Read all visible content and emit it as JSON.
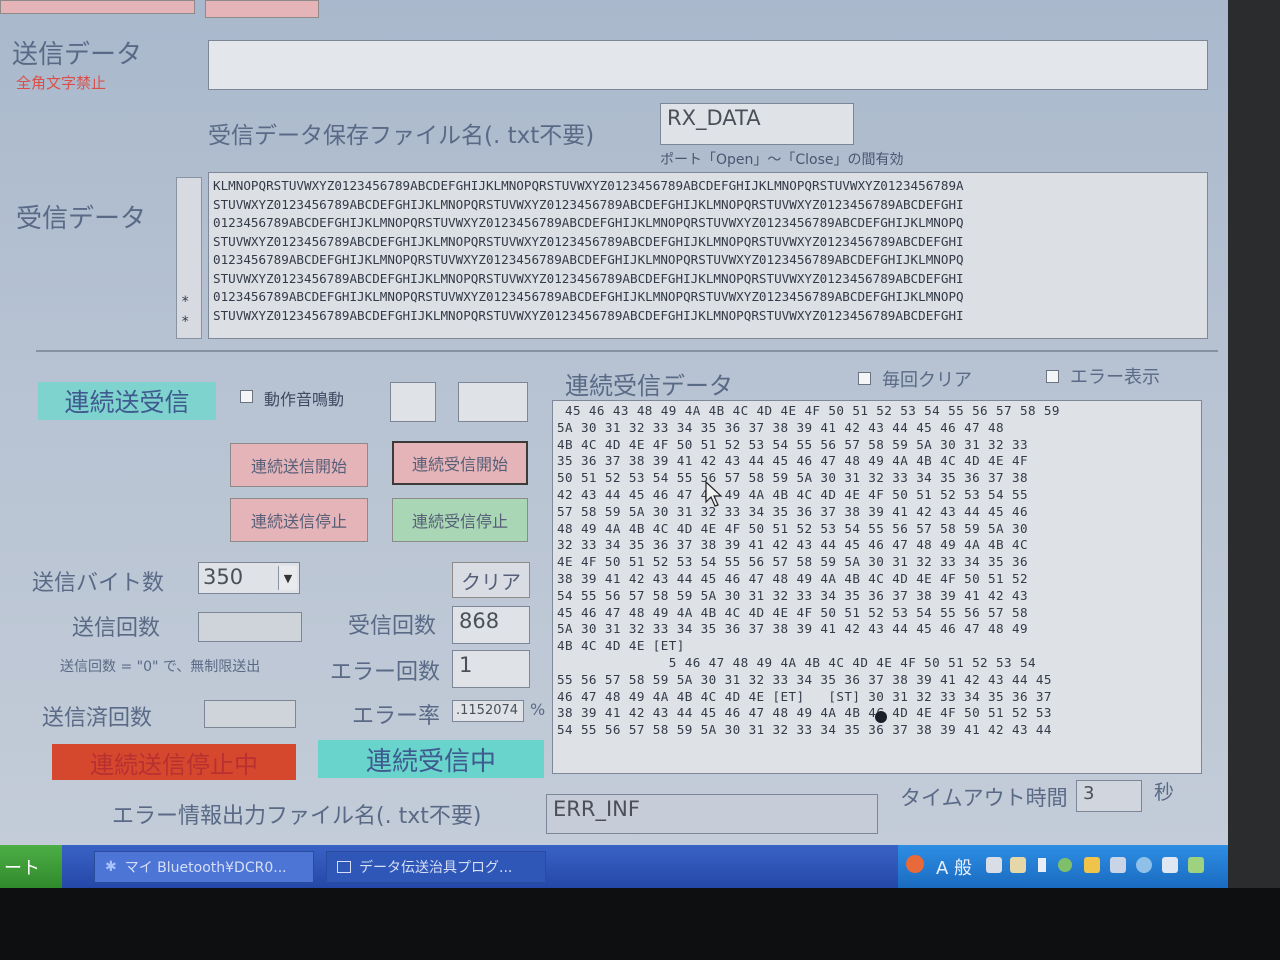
{
  "send": {
    "label": "送信データ",
    "note": "全角文字禁止",
    "value": ""
  },
  "rx_file": {
    "label": "受信データ保存ファイル名(. txt不要)",
    "value": "RX_DATA",
    "note": "ポート「Open」～「Close」の間有効"
  },
  "rx": {
    "label": "受信データ",
    "lines": [
      "KLMNOPQRSTUVWXYZ0123456789ABCDEFGHIJKLMNOPQRSTUVWXYZ0123456789ABCDEFGHIJKLMNOPQRSTUVWXYZ0123456789A",
      "STUVWXYZ0123456789ABCDEFGHIJKLMNOPQRSTUVWXYZ0123456789ABCDEFGHIJKLMNOPQRSTUVWXYZ0123456789ABCDEFGHI",
      "0123456789ABCDEFGHIJKLMNOPQRSTUVWXYZ0123456789ABCDEFGHIJKLMNOPQRSTUVWXYZ0123456789ABCDEFGHIJKLMNOPQ",
      "STUVWXYZ0123456789ABCDEFGHIJKLMNOPQRSTUVWXYZ0123456789ABCDEFGHIJKLMNOPQRSTUVWXYZ0123456789ABCDEFGHI",
      "0123456789ABCDEFGHIJKLMNOPQRSTUVWXYZ0123456789ABCDEFGHIJKLMNOPQRSTUVWXYZ0123456789ABCDEFGHIJKLMNOPQ",
      "STUVWXYZ0123456789ABCDEFGHIJKLMNOPQRSTUVWXYZ0123456789ABCDEFGHIJKLMNOPQRSTUVWXYZ0123456789ABCDEFGHI",
      "0123456789ABCDEFGHIJKLMNOPQRSTUVWXYZ0123456789ABCDEFGHIJKLMNOPQRSTUVWXYZ0123456789ABCDEFGHIJKLMNOPQ",
      "STUVWXYZ0123456789ABCDEFGHIJKLMNOPQRSTUVWXYZ0123456789ABCDEFGHIJKLMNOPQRSTUVWXYZ0123456789ABCDEFGHI"
    ],
    "markers": [
      "*",
      "*"
    ]
  },
  "continuous": {
    "title": "連続送受信",
    "sound_label": "動作音鳴動",
    "buttons": {
      "send_start": "連続送信開始",
      "recv_start": "連続受信開始",
      "send_stop": "連続送信停止",
      "recv_stop": "連続受信停止",
      "clear": "クリア"
    },
    "send_bytes_label": "送信バイト数",
    "send_bytes_value": "350",
    "send_count_label": "送信回数",
    "send_count_value": "",
    "recv_count_label": "受信回数",
    "recv_count_value": "868",
    "unlimited_note": "送信回数 = \"0\" で、無制限送出",
    "error_count_label": "エラー回数",
    "error_count_value": "1",
    "sent_count_label": "送信済回数",
    "sent_count_value": "",
    "error_rate_label": "エラー率",
    "error_rate_value": ".1152074",
    "error_rate_unit": "%",
    "status_send": "連続送信停止中",
    "status_recv": "連続受信中"
  },
  "hex": {
    "title": "連続受信データ",
    "clear_each_label": "毎回クリア",
    "show_error_label": "エラー表示",
    "rows": [
      " 45 46 43 48 49 4A 4B 4C 4D 4E 4F 50 51 52 53 54 55 56 57 58 59",
      "5A 30 31 32 33 34 35 36 37 38 39 41 42 43 44 45 46 47 48",
      "4B 4C 4D 4E 4F 50 51 52 53 54 55 56 57 58 59 5A 30 31 32 33",
      "35 36 37 38 39 41 42 43 44 45 46 47 48 49 4A 4B 4C 4D 4E 4F",
      "50 51 52 53 54 55 56 57 58 59 5A 30 31 32 33 34 35 36 37 38",
      "42 43 44 45 46 47 48 49 4A 4B 4C 4D 4E 4F 50 51 52 53 54 55",
      "57 58 59 5A 30 31 32 33 34 35 36 37 38 39 41 42 43 44 45 46",
      "48 49 4A 4B 4C 4D 4E 4F 50 51 52 53 54 55 56 57 58 59 5A 30",
      "32 33 34 35 36 37 38 39 41 42 43 44 45 46 47 48 49 4A 4B 4C",
      "4E 4F 50 51 52 53 54 55 56 57 58 59 5A 30 31 32 33 34 35 36",
      "38 39 41 42 43 44 45 46 47 48 49 4A 4B 4C 4D 4E 4F 50 51 52",
      "54 55 56 57 58 59 5A 30 31 32 33 34 35 36 37 38 39 41 42 43",
      "45 46 47 48 49 4A 4B 4C 4D 4E 4F 50 51 52 53 54 55 56 57 58",
      "5A 30 31 32 33 34 35 36 37 38 39 41 42 43 44 45 46 47 48 49",
      "4B 4C 4D 4E [ET]",
      "              5 46 47 48 49 4A 4B 4C 4D 4E 4F 50 51 52 53 54",
      "55 56 57 58 59 5A 30 31 32 33 34 35 36 37 38 39 41 42 43 44 45",
      "46 47 48 49 4A 4B 4C 4D 4E [ET]   [ST] 30 31 32 33 34 35 36 37",
      "38 39 41 42 43 44 45 46 47 48 49 4A 4B 4C 4D 4E 4F 50 51 52 53",
      "54 55 56 57 58 59 5A 30 31 32 33 34 35 36 37 38 39 41 42 43 44"
    ]
  },
  "err_file": {
    "label": "エラー情報出力ファイル名(. txt不要)",
    "value": "ERR_INF"
  },
  "timeout": {
    "label": "タイムアウト時間",
    "value": "3",
    "unit": "秒"
  },
  "taskbar": {
    "start_fragment": "ート",
    "tasks": [
      "マイ Bluetooth¥DCR0...",
      "データ伝送治具プログ..."
    ],
    "ime_label": "A 般"
  }
}
